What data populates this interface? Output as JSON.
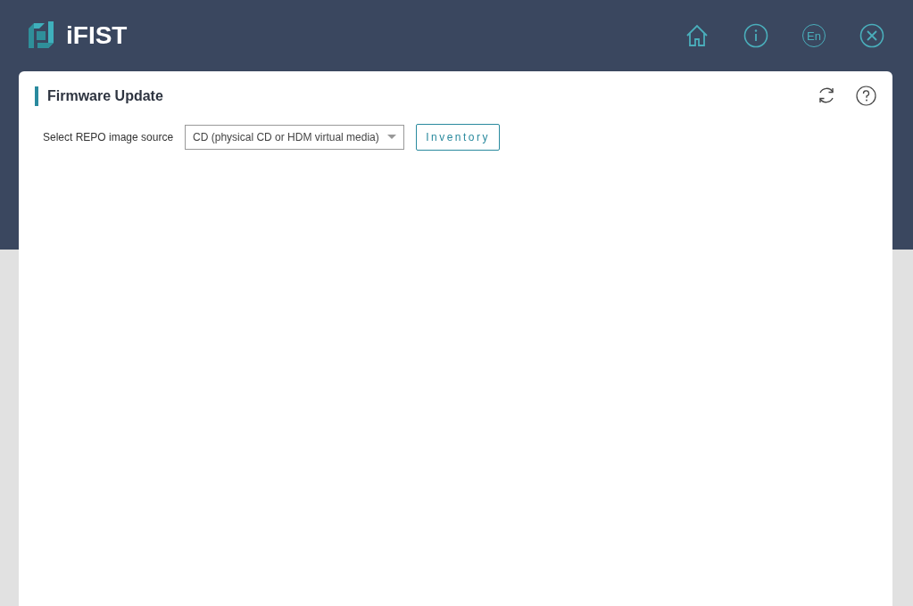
{
  "app": {
    "name": "iFIST"
  },
  "header": {
    "language_label": "En"
  },
  "panel": {
    "title": "Firmware Update",
    "source": {
      "label": "Select REPO image source",
      "value": "CD (physical CD or HDM virtual media)"
    },
    "inventory_button": "Inventory"
  }
}
